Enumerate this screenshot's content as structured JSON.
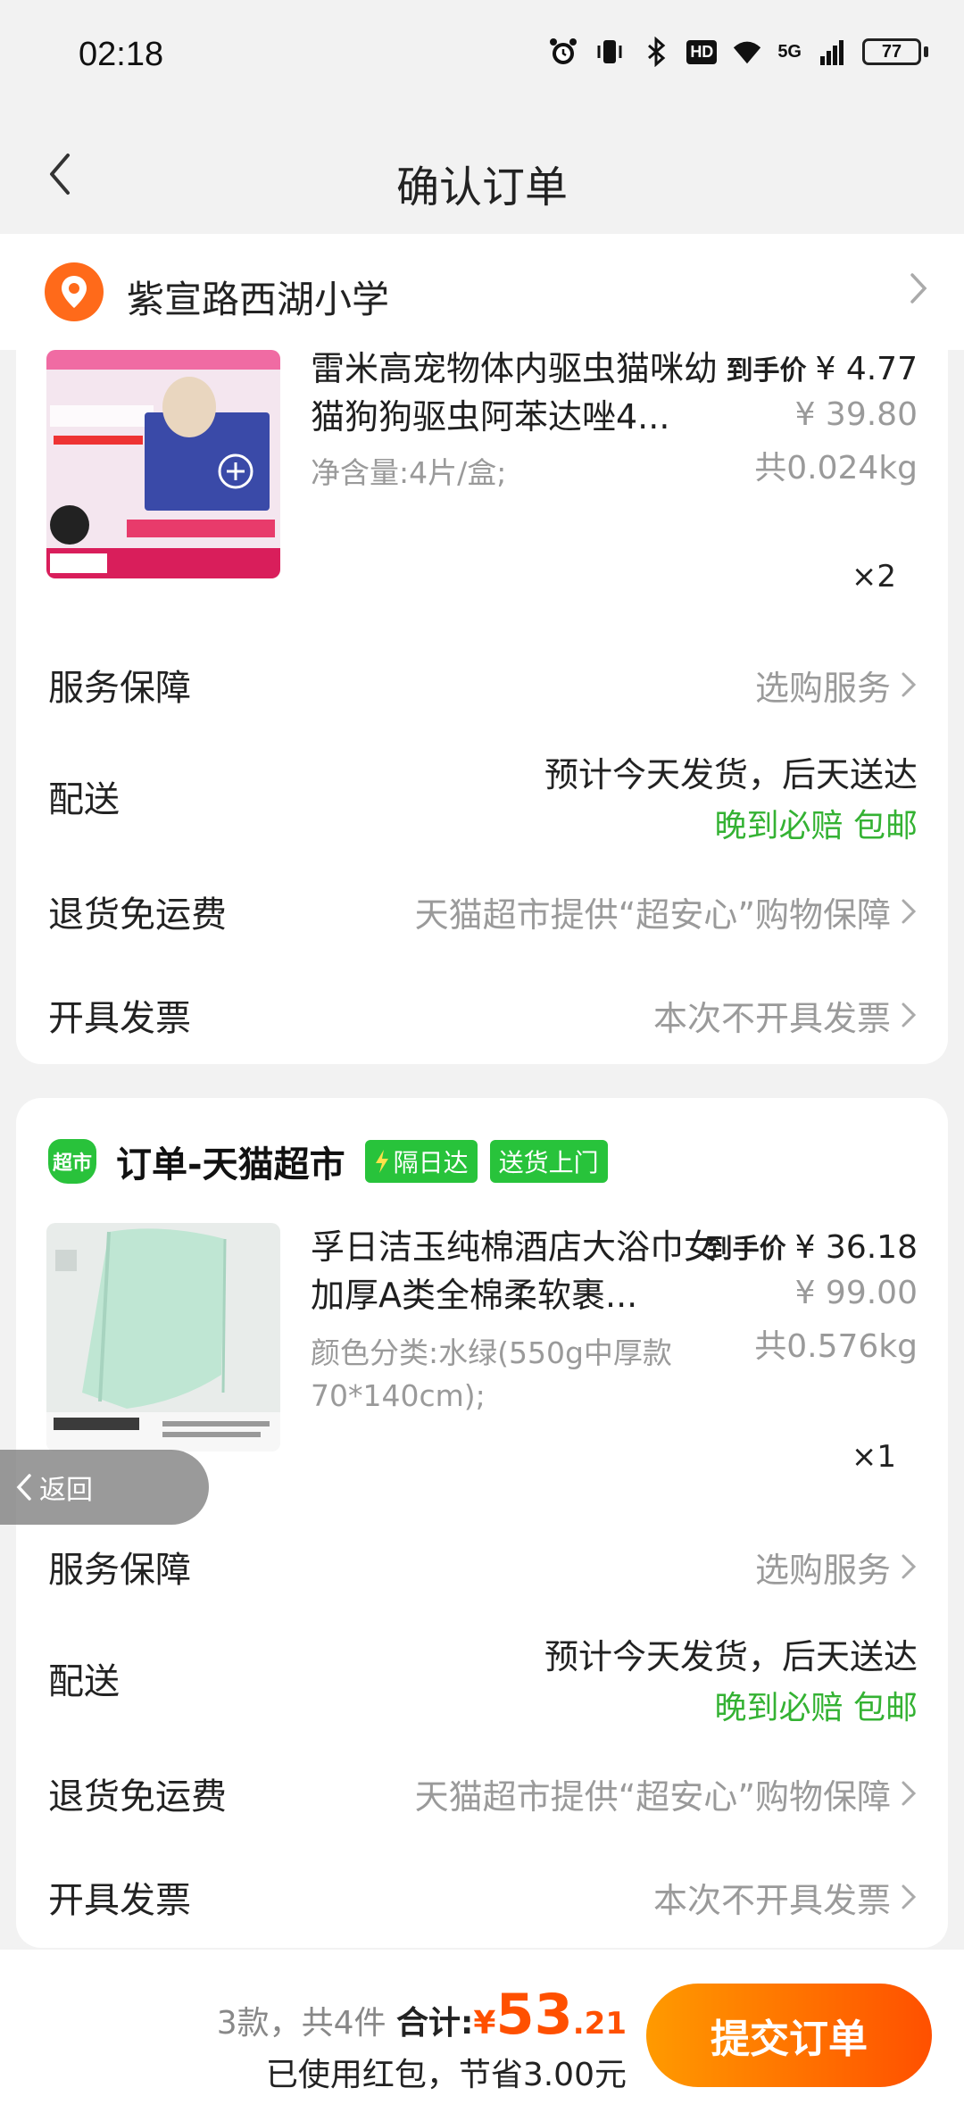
{
  "status": {
    "time": "02:18",
    "network": "5G",
    "hd": "HD",
    "battery": "77"
  },
  "nav": {
    "title": "确认订单"
  },
  "address": {
    "text": "紫宣路西湖小学"
  },
  "order1": {
    "product": {
      "title": "雷米高宠物体内驱虫猫咪幼猫狗狗驱虫阿苯达唑4...",
      "spec": "净含量:4片/盒;",
      "price_tag": "到手价",
      "price_final": "¥ 4.77",
      "price_orig": "¥ 39.80",
      "weight": "共0.024kg",
      "qty": "×2"
    },
    "rows": {
      "service_label": "服务保障",
      "service_value": "选购服务",
      "delivery_label": "配送",
      "delivery_value": "预计今天发货，后天送达",
      "delivery_badge": "晚到必赔 包邮",
      "return_label": "退货免运费",
      "return_value": "天猫超市提供“超安心”购物保障",
      "invoice_label": "开具发票",
      "invoice_value": "本次不开具发票"
    }
  },
  "order2": {
    "shop_logo": "超市",
    "shop_name": "订单-天猫超市",
    "badge1": "隔日达",
    "badge2": "送货上门",
    "product": {
      "title": "孚日洁玉纯棉酒店大浴巾女加厚A类全棉柔软裹...",
      "spec": "颜色分类:水绿(550g中厚款70*140cm);",
      "price_tag": "到手价",
      "price_final": "¥ 36.18",
      "price_orig": "¥ 99.00",
      "weight": "共0.576kg",
      "qty": "×1"
    },
    "rows": {
      "service_label": "服务保障",
      "service_value": "选购服务",
      "delivery_label": "配送",
      "delivery_value": "预计今天发货，后天送达",
      "delivery_badge": "晚到必赔 包邮",
      "return_label": "退货免运费",
      "return_value": "天猫超市提供“超安心”购物保障",
      "invoice_label": "开具发票",
      "invoice_value": "本次不开具发票"
    }
  },
  "float_back": "返回",
  "summary": {
    "count": "3款，共4件",
    "total_label": "合计:",
    "currency": "¥",
    "total_int": "53",
    "total_dec": ".21",
    "savings": "已使用红包，节省3.00元",
    "submit": "提交订单"
  },
  "colors": {
    "accent": "#ff5000",
    "green": "#34b233",
    "pin": "#ff6a1a"
  },
  "icons": [
    "back-icon",
    "location-pin-icon",
    "chevron-right-icon",
    "lightning-icon",
    "alarm-icon",
    "vibrate-icon",
    "bluetooth-icon",
    "wifi-icon",
    "signal-icon",
    "battery-icon"
  ]
}
